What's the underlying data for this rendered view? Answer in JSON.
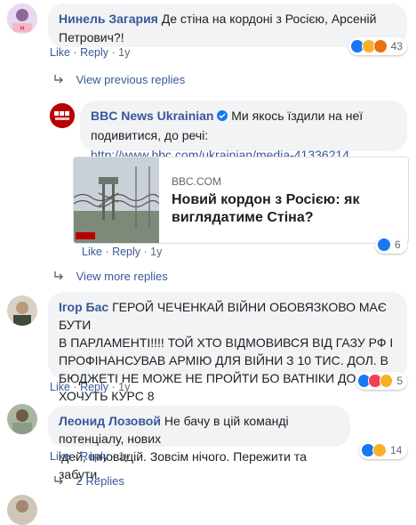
{
  "comments": [
    {
      "author": "Нинель Загария",
      "text_line1": "Де стіна на кордоні з Росією, Арсеній",
      "text_line2": "Петрович?!",
      "like": "Like",
      "reply": "Reply",
      "time": "1y",
      "reaction_count": "43"
    },
    {
      "author": "Ігор Бас",
      "text_line1": "ГЕРОЙ ЧЕЧЕНКАЙ ВІЙНИ ОБОВЯЗКОВО МАЄ БУТИ",
      "text_line2": "В ПАРЛАМЕНТІ!!!! ТОЙ ХТО ВІДМОВИВСЯ ВІД ГАЗУ РФ І",
      "text_line3": "ПРОФІНАНСУВАВ АРМІЮ ДЛЯ ВІЙНИ З 10 ТИС. ДОЛ. В",
      "text_line4": "БЮДЖЕТІ НЕ МОЖЕ НЕ ПРОЙТИ БО ВАТНІКИ ДОЛБ...И",
      "text_line5": "ХОЧУТЬ КУРС 8",
      "like": "Like",
      "reply": "Reply",
      "time": "1y",
      "reaction_count": "5"
    },
    {
      "author": "Леонид Лозовой",
      "text_line1": "Не бачу в цій команді потенціалу, нових",
      "text_line2": "ідей, інновацій. Зовсім нічого. Пережити та забути.",
      "like": "Like",
      "reply": "Reply",
      "time": "1y",
      "reaction_count": "14"
    }
  ],
  "view_previous": "View previous replies",
  "view_more": "View more replies",
  "two_replies": "2 Replies",
  "reply_comment": {
    "author": "BBC News Ukrainian",
    "logo_text": "BBC",
    "logo_sub": "NEWS",
    "text_line1": "Ми якось їздили на неї",
    "text_line2": "подивитися, до речі:",
    "url": "http://www.bbc.com/ukrainian/media-41336214",
    "card_domain": "BBC.COM",
    "card_title_line1": "Новий кордон з Росією: як",
    "card_title_line2": "виглядатиме Стіна?",
    "like": "Like",
    "reply": "Reply",
    "time": "1y",
    "reaction_count": "6"
  },
  "colors": {
    "link": "#385898",
    "like_blue": "#1877f2",
    "bubble": "#f2f3f5"
  }
}
